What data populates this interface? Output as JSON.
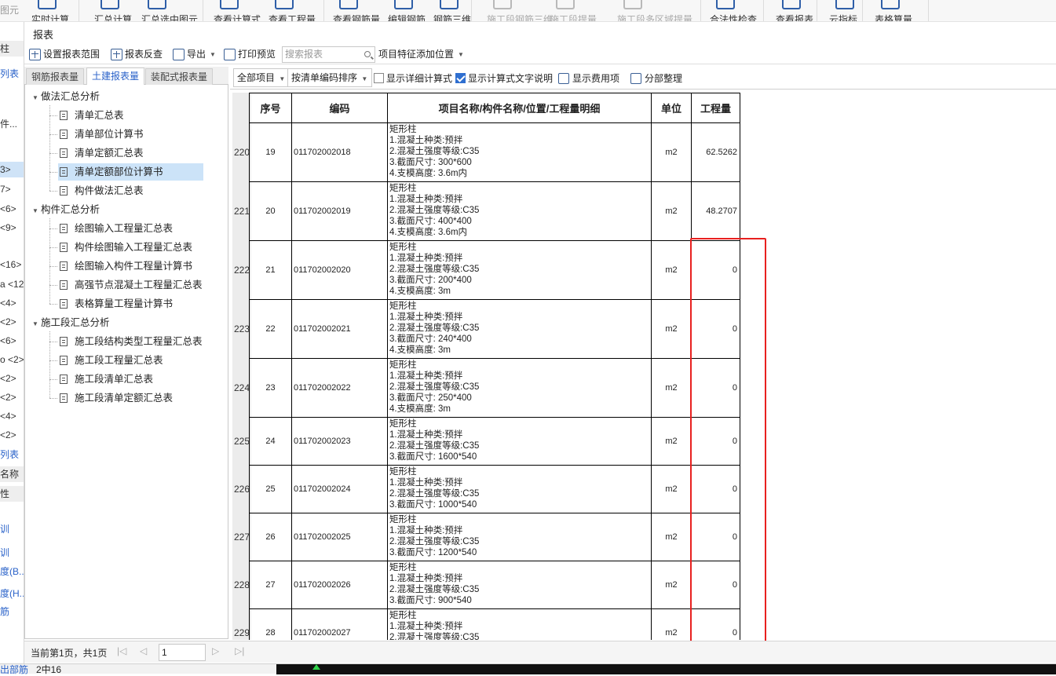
{
  "ribbon": {
    "items": [
      {
        "label": "实时计算",
        "disabled": false
      },
      {
        "label": "汇总计算",
        "disabled": false
      },
      {
        "label": "汇总选中图元",
        "disabled": false
      },
      {
        "label": "查看计算式",
        "disabled": false
      },
      {
        "label": "查看工程量",
        "disabled": false
      },
      {
        "label": "查看钢筋量",
        "disabled": false
      },
      {
        "label": "编辑钢筋",
        "disabled": false
      },
      {
        "label": "钢筋三维",
        "disabled": false
      },
      {
        "label": "施工段钢筋三维",
        "disabled": true
      },
      {
        "label": "施工段提量",
        "disabled": true
      },
      {
        "label": "施工段多区域提量",
        "disabled": true
      },
      {
        "label": "合法性检查",
        "disabled": false
      },
      {
        "label": "查看报表",
        "disabled": false
      },
      {
        "label": "云指标",
        "disabled": false
      },
      {
        "label": "表格算量",
        "disabled": false
      }
    ],
    "corner_text": "图元"
  },
  "left_strip": {
    "items": [
      "柱",
      "列表",
      "件...",
      "3>",
      "7>",
      "<6>",
      "<9>",
      "<16>",
      "a <12",
      "<4>",
      "<2>",
      "<6>",
      "o <2>",
      "<2>",
      "<2>",
      "<4>",
      "<2>",
      "列表",
      "名称",
      "性",
      "训",
      "训",
      "度(B...",
      "度(H...",
      "筋"
    ]
  },
  "report_title": "报表",
  "toolbar": {
    "set_range": "设置报表范围",
    "reverse_check": "报表反查",
    "export": "导出",
    "print_preview": "打印预览",
    "search_placeholder": "搜索报表",
    "feature_position": "项目特征添加位置"
  },
  "tabs": [
    {
      "label": "钢筋报表量",
      "active": false
    },
    {
      "label": "土建报表量",
      "active": true
    },
    {
      "label": "装配式报表量",
      "active": false
    }
  ],
  "tree": {
    "groups": [
      {
        "label": "做法汇总分析",
        "items": [
          "清单汇总表",
          "清单部位计算书",
          "清单定额汇总表",
          "清单定额部位计算书",
          "构件做法汇总表"
        ],
        "selected": 3
      },
      {
        "label": "构件汇总分析",
        "items": [
          "绘图输入工程量汇总表",
          "构件绘图输入工程量汇总表",
          "绘图输入构件工程量计算书",
          "高强节点混凝土工程量汇总表",
          "表格算量工程量计算书"
        ],
        "selected": -1
      },
      {
        "label": "施工段汇总分析",
        "items": [
          "施工段结构类型工程量汇总表",
          "施工段工程量汇总表",
          "施工段清单汇总表",
          "施工段清单定额汇总表"
        ],
        "selected": -1
      }
    ]
  },
  "options": {
    "all_items": "全部项目",
    "sort_by": "按清单编码排序",
    "show_detail_formula": "显示详细计算式",
    "show_detail_formula_checked": false,
    "show_formula_text": "显示计算式文字说明",
    "show_formula_text_checked": true,
    "show_cost_items": "显示费用项",
    "section_sort": "分部整理"
  },
  "table": {
    "headers": [
      "序号",
      "编码",
      "项目名称/构件名称/位置/工程量明细",
      "单位",
      "工程量"
    ],
    "rows": [
      {
        "rownum": "220",
        "seq": "19",
        "code": "011702002018",
        "name": [
          "矩形柱",
          "1.混凝土种类:预拌",
          "2.混凝土强度等级:C35",
          "3.截面尺寸: 300*600",
          "4.支模高度: 3.6m内"
        ],
        "unit": "m2",
        "qty": "62.5262"
      },
      {
        "rownum": "221",
        "seq": "20",
        "code": "011702002019",
        "name": [
          "矩形柱",
          "1.混凝土种类:预拌",
          "2.混凝土强度等级:C35",
          "3.截面尺寸: 400*400",
          "4.支模高度: 3.6m内"
        ],
        "unit": "m2",
        "qty": "48.2707"
      },
      {
        "rownum": "222",
        "seq": "21",
        "code": "011702002020",
        "name": [
          "矩形柱",
          "1.混凝土种类:预拌",
          "2.混凝土强度等级:C35",
          "3.截面尺寸: 200*400",
          "4.支模高度: 3m"
        ],
        "unit": "m2",
        "qty": "0"
      },
      {
        "rownum": "223",
        "seq": "22",
        "code": "011702002021",
        "name": [
          "矩形柱",
          "1.混凝土种类:预拌",
          "2.混凝土强度等级:C35",
          "3.截面尺寸: 240*400",
          "4.支模高度: 3m"
        ],
        "unit": "m2",
        "qty": "0"
      },
      {
        "rownum": "224",
        "seq": "23",
        "code": "011702002022",
        "name": [
          "矩形柱",
          "1.混凝土种类:预拌",
          "2.混凝土强度等级:C35",
          "3.截面尺寸: 250*400",
          "4.支模高度: 3m"
        ],
        "unit": "m2",
        "qty": "0"
      },
      {
        "rownum": "225",
        "seq": "24",
        "code": "011702002023",
        "name": [
          "矩形柱",
          "1.混凝土种类:预拌",
          "2.混凝土强度等级:C35",
          "3.截面尺寸: 1600*540"
        ],
        "unit": "m2",
        "qty": "0"
      },
      {
        "rownum": "226",
        "seq": "25",
        "code": "011702002024",
        "name": [
          "矩形柱",
          "1.混凝土种类:预拌",
          "2.混凝土强度等级:C35",
          "3.截面尺寸: 1000*540"
        ],
        "unit": "m2",
        "qty": "0"
      },
      {
        "rownum": "227",
        "seq": "26",
        "code": "011702002025",
        "name": [
          "矩形柱",
          "1.混凝土种类:预拌",
          "2.混凝土强度等级:C35",
          "3.截面尺寸: 1200*540"
        ],
        "unit": "m2",
        "qty": "0"
      },
      {
        "rownum": "228",
        "seq": "27",
        "code": "011702002026",
        "name": [
          "矩形柱",
          "1.混凝土种类:预拌",
          "2.混凝土强度等级:C35",
          "3.截面尺寸: 900*540"
        ],
        "unit": "m2",
        "qty": "0"
      },
      {
        "rownum": "229",
        "seq": "28",
        "code": "011702002027",
        "name": [
          "矩形柱",
          "1.混凝土种类:预拌",
          "2.混凝土强度等级:C35"
        ],
        "unit": "m2",
        "qty": "0"
      }
    ]
  },
  "pager": {
    "info": "当前第1页，共1页",
    "page_value": "1"
  },
  "status": {
    "left": "出部筋",
    "mid": "2中16"
  },
  "colors": {
    "accent": "#2a62c9",
    "highlight": "#e8201f",
    "selection": "#cce3f8"
  }
}
